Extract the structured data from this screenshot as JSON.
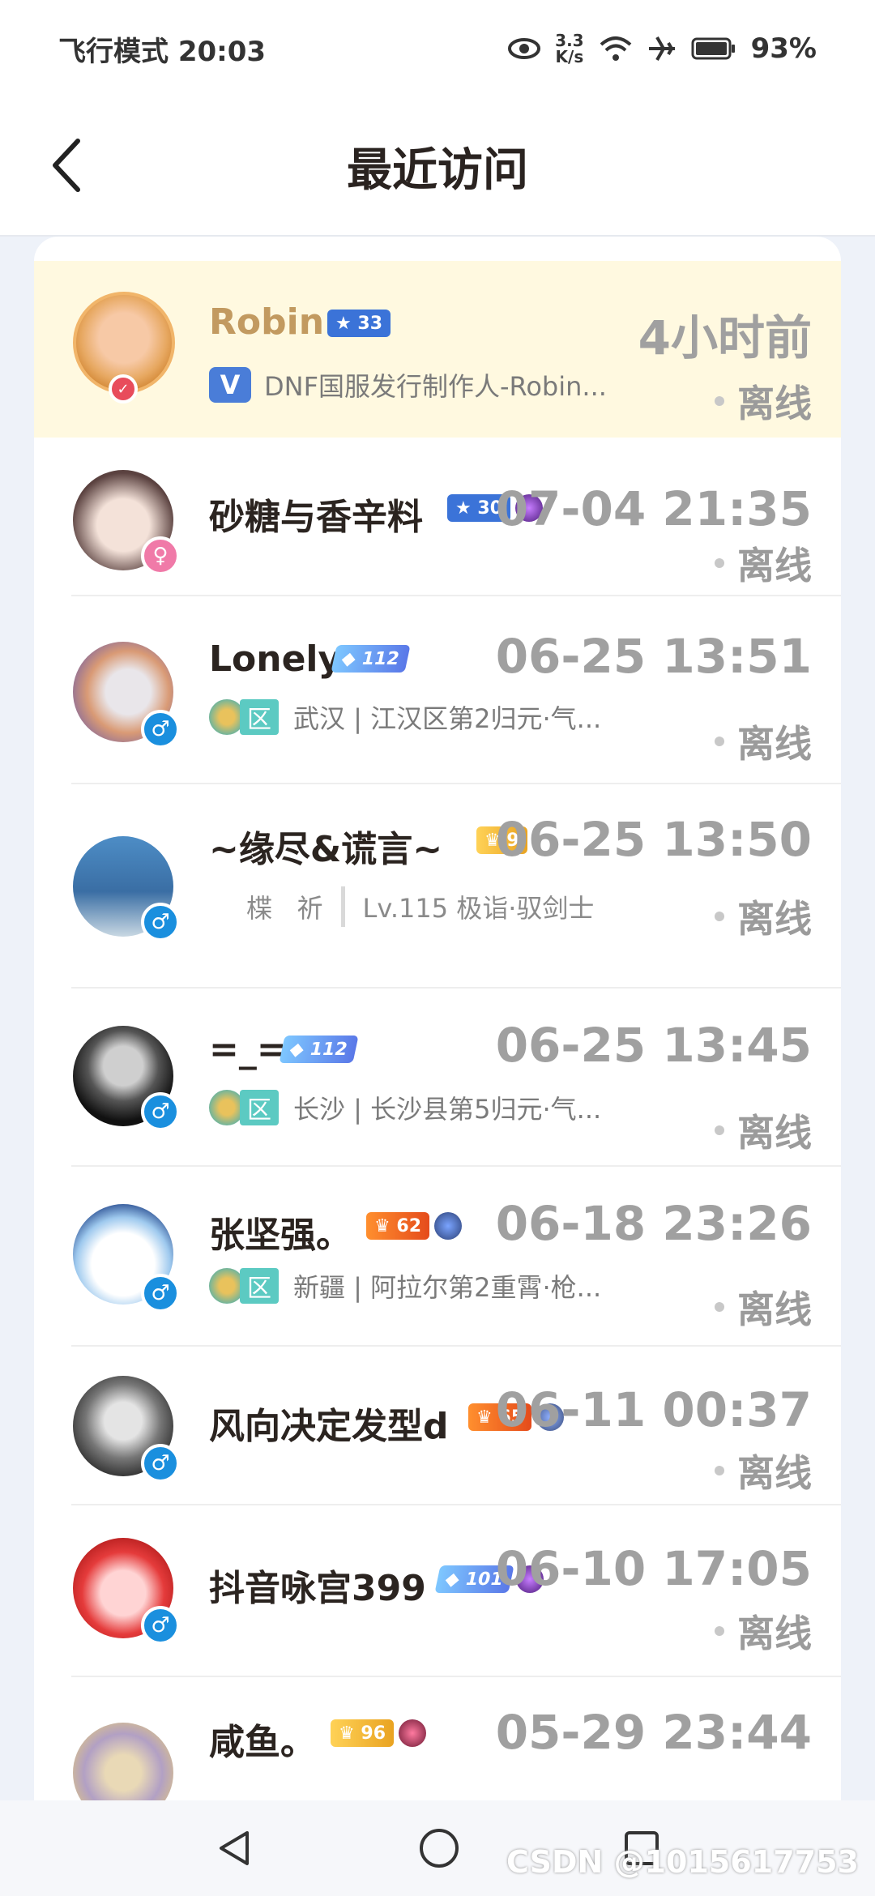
{
  "status_bar": {
    "left_text": "飞行模式 20:03",
    "speed_value": "3.3",
    "speed_unit": "K/s",
    "battery": "93%"
  },
  "header": {
    "title": "最近访问"
  },
  "visitors": [
    {
      "name": "Robin",
      "level": "33",
      "time": "4小时前",
      "status": "离线",
      "subtitle": "DNF国服发行制作人-Robin...",
      "highlight": true
    },
    {
      "name": "砂糖与香辛料",
      "level": "30",
      "time": "07-04 21:35",
      "status": "离线",
      "gender": "♀"
    },
    {
      "name": "Lonely",
      "level": "112",
      "time": "06-25 13:51",
      "status": "离线",
      "region_badge": "区",
      "subtitle": "武汉 | 江汉区第2归元·气...",
      "gender": "♂"
    },
    {
      "name": "~缘尽&谎言~",
      "level": "9",
      "time": "06-25 13:50",
      "status": "离线",
      "subtitle_left": "楪   祈",
      "subtitle_right": "Lv.115 极诣·驭剑士",
      "gender": "♂"
    },
    {
      "name": "=_=",
      "level": "112",
      "time": "06-25 13:45",
      "status": "离线",
      "region_badge": "区",
      "subtitle": "长沙 | 长沙县第5归元·气...",
      "gender": "♂"
    },
    {
      "name": "张坚强。",
      "level": "62",
      "time": "06-18 23:26",
      "status": "离线",
      "region_badge": "区",
      "subtitle": "新疆 | 阿拉尔第2重霄·枪...",
      "gender": "♂"
    },
    {
      "name": "风向决定发型d",
      "level": "65",
      "time": "06-11 00:37",
      "status": "离线",
      "gender": "♂"
    },
    {
      "name": "抖音咏宫399",
      "level": "101",
      "time": "06-10 17:05",
      "status": "离线",
      "gender": "♂"
    },
    {
      "name": "咸鱼。",
      "level": "96",
      "time": "05-29 23:44"
    }
  ],
  "watermark": "CSDN @1015617753",
  "colors": {
    "accent_gold": "#c29a60",
    "highlight_bg": "#fff9e0",
    "time_gray": "#a0a0a0"
  }
}
